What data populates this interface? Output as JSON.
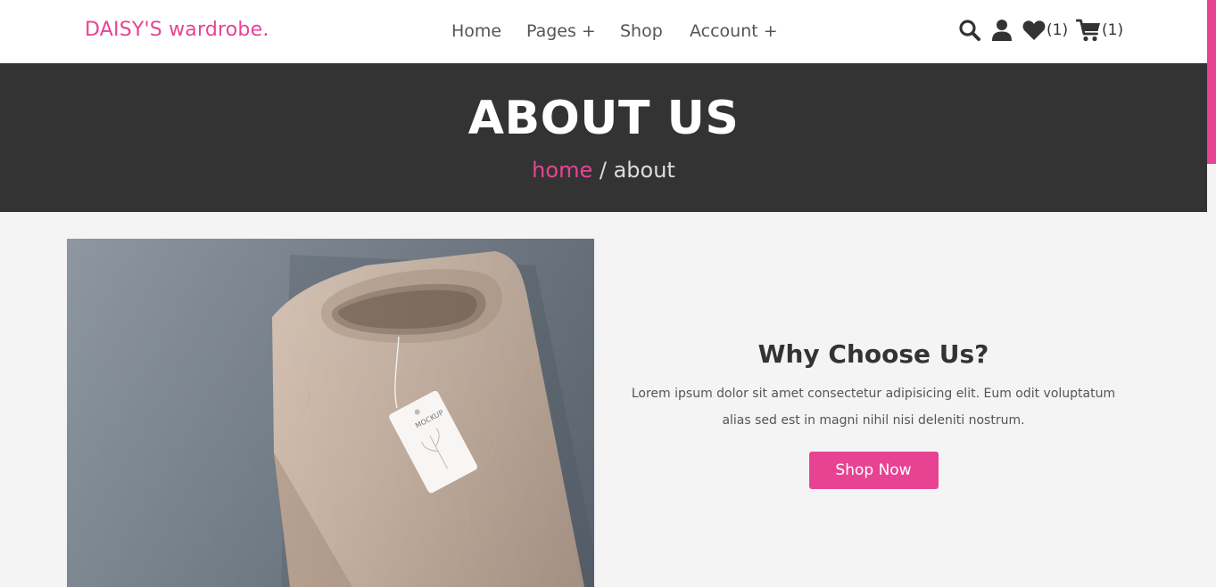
{
  "header": {
    "logo": "DAISY'S wardrobe.",
    "nav": [
      "Home",
      "Pages +",
      "Shop",
      "Account +"
    ],
    "wishlist_count": "(1)",
    "cart_count": "(1)",
    "icons": [
      "search-icon",
      "user-icon",
      "heart-icon",
      "cart-icon"
    ]
  },
  "banner": {
    "title": "ABOUT US",
    "breadcrumb_home": "home",
    "breadcrumb_separator": " / ",
    "breadcrumb_current": "about"
  },
  "about": {
    "heading": "Why Choose Us?",
    "text": "Lorem ipsum dolor sit amet consectetur adipisicing elit. Eum odit voluptatum alias sed est in magni nihil nisi deleniti nostrum.",
    "button": "Shop Now",
    "tag_text": "MOCKUP"
  },
  "colors": {
    "accent": "#e84393",
    "dark": "#333333",
    "background": "#f4f4f4"
  }
}
